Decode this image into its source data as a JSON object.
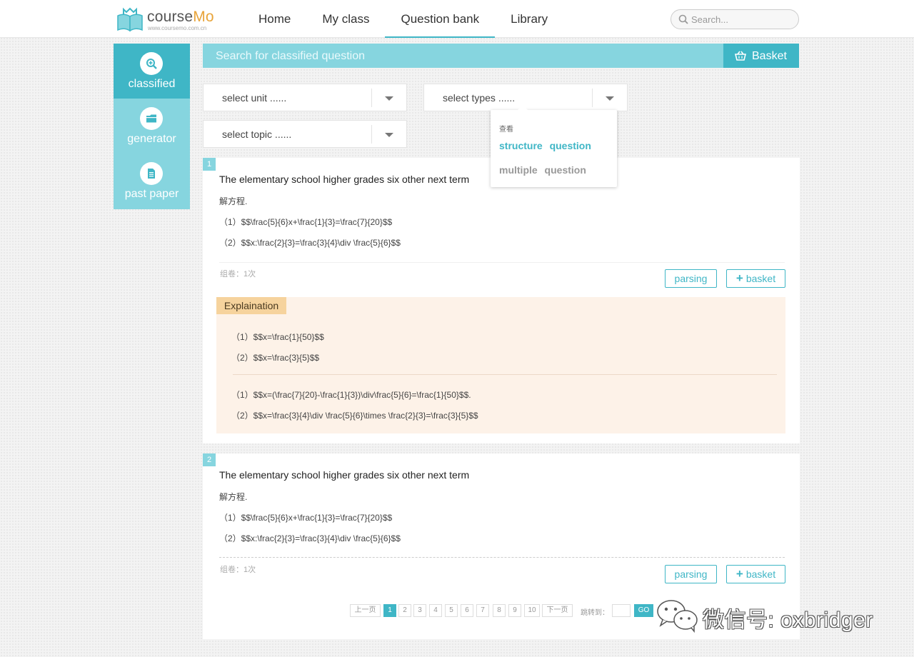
{
  "header": {
    "logo_main": "course",
    "logo_accent": "Mo",
    "logo_url": "www.coursemo.com.cn",
    "nav": [
      {
        "label": "Home",
        "active": false
      },
      {
        "label": "My class",
        "active": false
      },
      {
        "label": "Question bank",
        "active": true
      },
      {
        "label": "Library",
        "active": false
      }
    ],
    "search_placeholder": "Search..."
  },
  "sidebar": {
    "items": [
      {
        "label": "classified",
        "icon": "search-zoom-icon",
        "active": true
      },
      {
        "label": "generator",
        "icon": "folder-icon",
        "active": false
      },
      {
        "label": "past paper",
        "icon": "document-icon",
        "active": false
      }
    ]
  },
  "toolbar": {
    "search_text": "Search for classified question",
    "basket_label": "Basket"
  },
  "filters": {
    "unit": "select unit ......",
    "types": "select types ......",
    "topic": "select topic ......"
  },
  "dropdown": {
    "header": "查看",
    "options": [
      {
        "label": "structure question",
        "selected": true
      },
      {
        "label": "multiple question",
        "selected": false
      }
    ]
  },
  "questions": [
    {
      "number": "1",
      "title": "The elementary school higher grades six other next term",
      "instruction": "解方程.",
      "lines": [
        "（1）$$\\frac{5}{6}x+\\frac{1}{3}=\\frac{7}{20}$$",
        "（2）$$x:\\frac{2}{3}=\\frac{3}{4}\\div \\frac{5}{6}$$"
      ],
      "meta": "组卷：1次",
      "parsing_label": "parsing",
      "basket_label": "basket",
      "explanation": {
        "tag": "Explaination",
        "answers": [
          "（1）$$x=\\frac{1}{50}$$",
          "（2）$$x=\\frac{3}{5}$$"
        ],
        "steps": [
          "（1）$$x=(\\frac{7}{20}-\\frac{1}{3})\\div\\frac{5}{6}=\\frac{1}{50}$$.",
          "（2）$$x=\\frac{3}{4}\\div \\frac{5}{6}\\times \\frac{2}{3}=\\frac{3}{5}$$"
        ]
      }
    },
    {
      "number": "2",
      "title": "The elementary school higher grades six other next term",
      "instruction": "解方程.",
      "lines": [
        "（1）$$\\frac{5}{6}x+\\frac{1}{3}=\\frac{7}{20}$$",
        "（2）$$x:\\frac{2}{3}=\\frac{3}{4}\\div \\frac{5}{6}$$"
      ],
      "meta": "组卷：1次",
      "parsing_label": "parsing",
      "basket_label": "basket"
    }
  ],
  "pagination": {
    "prev": "上一页",
    "pages": [
      "1",
      "2",
      "3",
      "4",
      "5",
      "6",
      "7",
      "8",
      "9",
      "10"
    ],
    "current": "1",
    "next": "下一页",
    "jump_label": "跳转到：",
    "go": "GO"
  },
  "watermark": {
    "text": "微信号: oxbridger"
  },
  "colors": {
    "accent": "#3fb6c6",
    "accent_light": "#86d5df",
    "explanation_bg": "#fdf2e8",
    "explanation_tag": "#f6d39d"
  }
}
